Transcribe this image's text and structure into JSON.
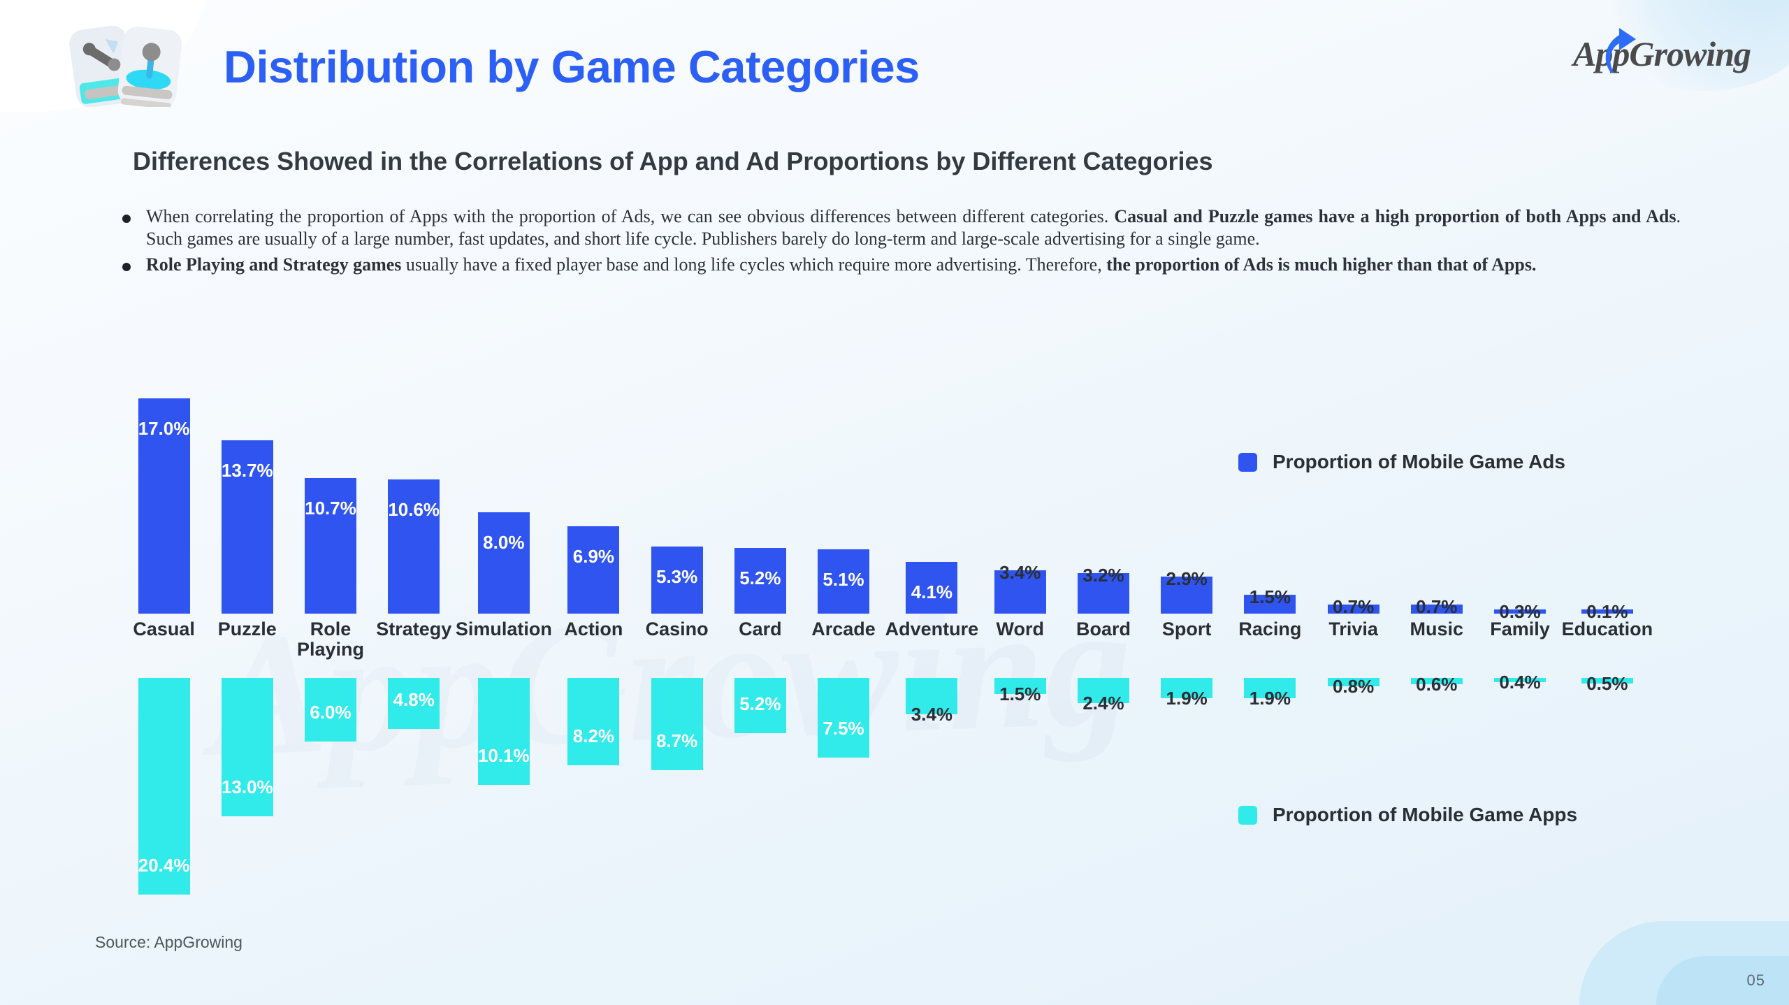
{
  "header": {
    "title": "Distribution by Game Categories",
    "logo_text": "AppGrowing",
    "icon_name": "game-cards-icon"
  },
  "subtitle": "Differences Showed in the Correlations of App and Ad Proportions by Different Categories",
  "bullets": [
    {
      "id": "bullet-1",
      "segments": [
        {
          "text": "When correlating the proportion of Apps with the proportion of Ads, we can see obvious differences between different categories. ",
          "bold": false
        },
        {
          "text": "Casual and Puzzle games have a high proportion of both Apps and Ads",
          "bold": true
        },
        {
          "text": ". Such games are usually of a large number, fast updates, and short life cycle. Publishers barely do long-term and large-scale advertising for a single game.",
          "bold": false
        }
      ]
    },
    {
      "id": "bullet-2",
      "segments": [
        {
          "text": "Role Playing and Strategy games",
          "bold": true
        },
        {
          "text": " usually have a fixed player base and long life cycles which require more advertising. Therefore, ",
          "bold": false
        },
        {
          "text": "the proportion of Ads is much higher than that of Apps.",
          "bold": true
        }
      ]
    }
  ],
  "legend": {
    "ads_label": "Proportion of Mobile Game Ads",
    "apps_label": "Proportion of Mobile Game Apps",
    "ads_color": "#2f54f0",
    "apps_color": "#31eaea"
  },
  "source": "Source: AppGrowing",
  "page_number": "05",
  "watermark": "AppGrowing",
  "chart_data": {
    "type": "bar",
    "title": "Distribution by Game Categories",
    "xlabel": "",
    "ylabel": "",
    "orientation": "vertical-diverging",
    "categories": [
      "Casual",
      "Puzzle",
      "Role\nPlaying",
      "Strategy",
      "Simulation",
      "Action",
      "Casino",
      "Card",
      "Arcade",
      "Adventure",
      "Word",
      "Board",
      "Sport",
      "Racing",
      "Trivia",
      "Music",
      "Family",
      "Education"
    ],
    "series": [
      {
        "name": "Proportion of Mobile Game Ads",
        "color": "#2f54f0",
        "direction": "up",
        "values": [
          17.0,
          13.7,
          10.7,
          10.6,
          8.0,
          6.9,
          5.3,
          5.2,
          5.1,
          4.1,
          3.4,
          3.2,
          2.9,
          1.5,
          0.7,
          0.7,
          0.3,
          0.1
        ],
        "labels": [
          "17.0%",
          "13.7%",
          "10.7%",
          "10.6%",
          "8.0%",
          "6.9%",
          "5.3%",
          "5.2%",
          "5.1%",
          "4.1%",
          "3.4%",
          "3.2%",
          "2.9%",
          "1.5%",
          "0.7%",
          "0.7%",
          "0.3%",
          "0.1%"
        ]
      },
      {
        "name": "Proportion of Mobile Game Apps",
        "color": "#31eaea",
        "direction": "down",
        "values": [
          20.4,
          13.0,
          6.0,
          4.8,
          10.1,
          8.2,
          8.7,
          5.2,
          7.5,
          3.4,
          1.5,
          2.4,
          1.9,
          1.9,
          0.8,
          0.6,
          0.4,
          0.5
        ],
        "labels": [
          "20.4%",
          "13.0%",
          "6.0%",
          "4.8%",
          "10.1%",
          "8.2%",
          "8.7%",
          "5.2%",
          "7.5%",
          "3.4%",
          "1.5%",
          "2.4%",
          "1.9%",
          "1.9%",
          "0.8%",
          "0.6%",
          "0.4%",
          "0.5%"
        ]
      }
    ],
    "grid": false,
    "legend_position": "right"
  }
}
